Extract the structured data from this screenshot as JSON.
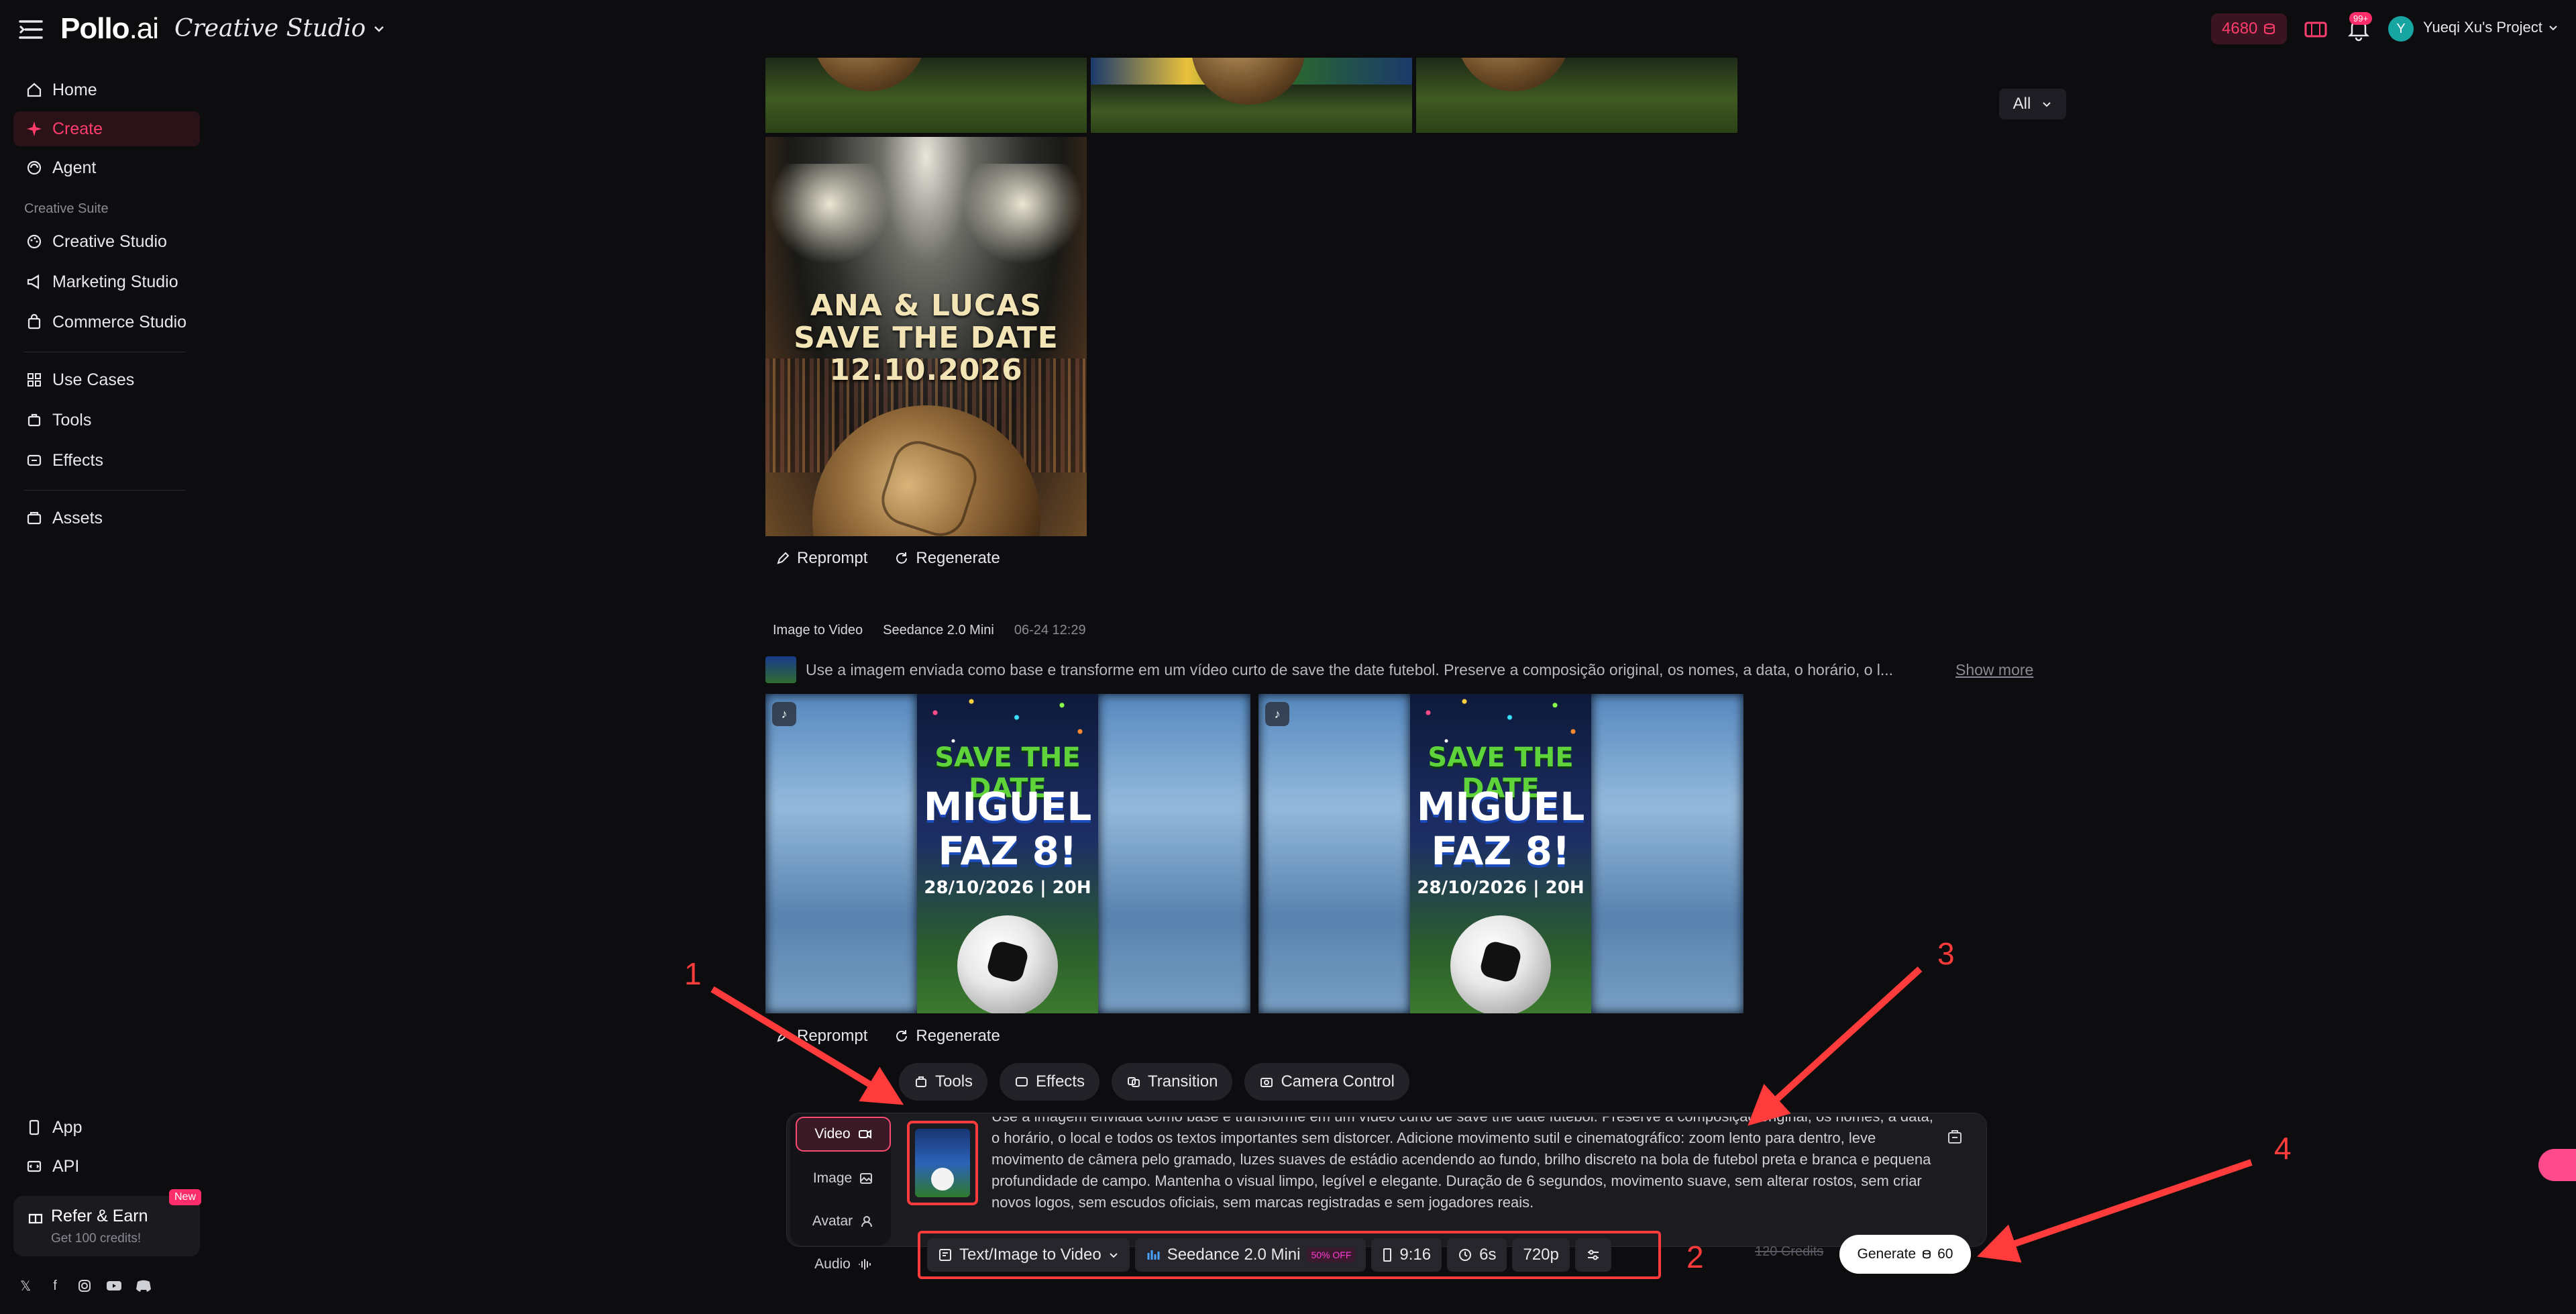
{
  "header": {
    "logo_main": "Pollo",
    "logo_suffix": ".ai",
    "studio_title": "Creative Studio",
    "credits": "4680",
    "notifications_badge": "99+",
    "avatar_letter": "Y",
    "project_name": "Yueqi Xu's Project"
  },
  "sidebar": {
    "items": [
      {
        "label": "Home",
        "icon": "home-icon"
      },
      {
        "label": "Create",
        "icon": "sparkle-icon"
      },
      {
        "label": "Agent",
        "icon": "agent-icon"
      }
    ],
    "section_label": "Creative Suite",
    "suite": [
      {
        "label": "Creative Studio",
        "icon": "palette-icon"
      },
      {
        "label": "Marketing Studio",
        "icon": "megaphone-icon"
      },
      {
        "label": "Commerce Studio",
        "icon": "bag-icon"
      }
    ],
    "more": [
      {
        "label": "Use Cases",
        "icon": "grid-icon"
      },
      {
        "label": "Tools",
        "icon": "tools-icon"
      },
      {
        "label": "Effects",
        "icon": "effects-icon"
      }
    ],
    "assets": "Assets",
    "app": "App",
    "api": "API",
    "refer_title": "Refer & Earn",
    "refer_sub": "Get 100 credits!",
    "refer_badge": "New",
    "socials": [
      "x-icon",
      "facebook-icon",
      "instagram-icon",
      "youtube-icon",
      "discord-icon"
    ]
  },
  "gallery": {
    "filter": "All",
    "poster_line1": "ANA & LUCAS",
    "poster_line2": "SAVE THE DATE",
    "poster_line3": "12.10.2026",
    "reprompt": "Reprompt",
    "regenerate": "Regenerate",
    "meta_type": "Image to Video",
    "meta_model": "Seedance 2.0 Mini",
    "meta_date": "06-24 12:29",
    "prompt_preview": "Use a imagem enviada como base e transforme em um vídeo curto de save the date futebol. Preserve a composição original, os nomes, a data, o horário, o l...",
    "show_more": "Show more",
    "video_save": "SAVE THE DATE",
    "video_name1": "MIGUEL",
    "video_name2": "FAZ 8!",
    "video_date": "28/10/2026 | 20H"
  },
  "composer": {
    "chips": [
      "Tools",
      "Effects",
      "Transition",
      "Camera Control"
    ],
    "modes": [
      "Video",
      "Image",
      "Avatar",
      "Audio"
    ],
    "prompt_text": "Use a imagem enviada como base e transforme em um vídeo curto de save the date futebol. Preserve a composição original, os nomes, a data, o horário, o local e todos os textos importantes sem distorcer. Adicione movimento sutil e cinematográfico: zoom lento para dentro, leve movimento de câmera pelo gramado, luzes suaves de estádio acendendo ao fundo, brilho discreto na bola de futebol preta e branca e pequena profundidade de campo. Mantenha o visual limpo, legível e elegante. Duração de 6 segundos, movimento suave, sem alterar rostos, sem criar novos logos, sem escudos oficiais, sem marcas registradas e sem jogadores reais.",
    "mode_select": "Text/Image to Video",
    "model": "Seedance 2.0 Mini",
    "discount": "50% OFF",
    "ratio": "9:16",
    "duration": "6s",
    "resolution": "720p",
    "old_cost": "120 Credits",
    "generate_label": "Generate",
    "generate_cost": "60"
  },
  "annotations": [
    "1",
    "2",
    "3",
    "4"
  ],
  "colors": {
    "accent": "#ff3d6c",
    "annotation": "#ff3b3b",
    "background": "#0d0d10"
  }
}
